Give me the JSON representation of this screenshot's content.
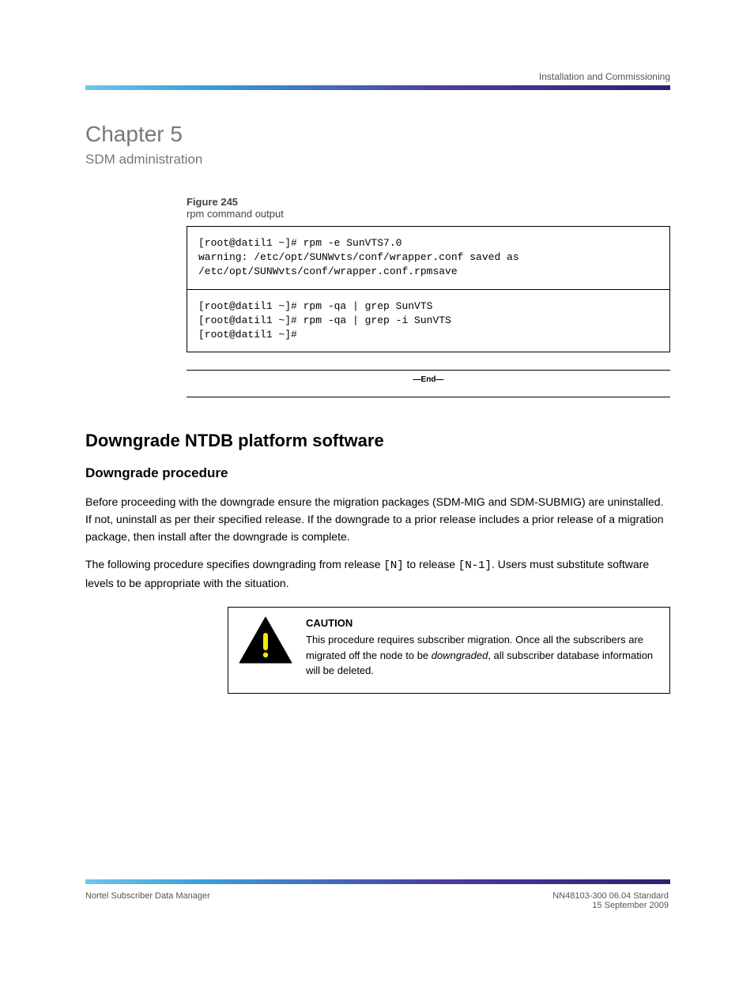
{
  "header": {
    "page_title": "Installation and Commissioning"
  },
  "chapter": {
    "number": "Chapter 5",
    "name": "SDM administration"
  },
  "figure": {
    "number": "Figure 245",
    "caption": "rpm command output"
  },
  "rpm_output": {
    "row1_l1": "[root@datil1 ~]# rpm -e SunVTS7.0",
    "row1_l2": "warning: /etc/opt/SUNWvts/conf/wrapper.conf saved as",
    "row1_l3": "/etc/opt/SUNWvts/conf/wrapper.conf.rpmsave",
    "row2_l1": "[root@datil1 ~]# rpm -qa | grep SunVTS",
    "row2_l2": "[root@datil1 ~]# rpm -qa | grep -i SunVTS",
    "row2_l3": "[root@datil1 ~]#"
  },
  "end_procedure": "—End—",
  "section": {
    "title": "Downgrade NTDB platform software",
    "sub_title": "Downgrade procedure",
    "p1": "Before proceeding with the downgrade ensure the migration packages (SDM-MIG and SDM-SUBMIG) are uninstalled. If not, uninstall as per their specified release. If the downgrade to a prior release includes a prior release of a migration package, then install after the downgrade is complete.",
    "p2_a": "The following procedure specifies downgrading from release ",
    "p2_b": " to release ",
    "p2_c": ". Users must substitute software levels to be appropriate with the situation.",
    "bracket_n": "[N]",
    "bracket_n1": "[N-1]"
  },
  "caution": {
    "label": "CAUTION",
    "line1": "This procedure requires subscriber migration. Once all the subscribers are migrated off the node to be ",
    "line2": ", all subscriber database information will be deleted.",
    "downgraded": "downgraded"
  },
  "footer": {
    "left": "Nortel Subscriber Data Manager",
    "right": "NN48103-300 06.04 Standard\n15 September 2009"
  }
}
